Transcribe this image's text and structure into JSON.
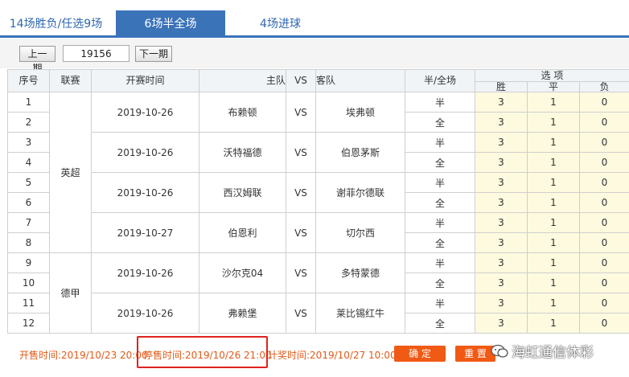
{
  "tabs": [
    {
      "label": "14场胜负/任选9场"
    },
    {
      "label": "6场半全场"
    },
    {
      "label": "4场进球"
    }
  ],
  "toolbar": {
    "prev_label": "上一期",
    "issue_value": "19156",
    "next_label": "下一期"
  },
  "table": {
    "headers": {
      "seq": "序号",
      "league": "联赛",
      "start_time": "开赛时间",
      "home": "主队",
      "vs": "VS",
      "away": "客队",
      "half_full": "半/全场",
      "options": "选 项",
      "win": "胜",
      "draw": "平",
      "lose": "负"
    },
    "matches": [
      {
        "league": "英超",
        "date": "2019-10-26",
        "home": "布赖顿",
        "away": "埃弗顿"
      },
      {
        "league": "英超",
        "date": "2019-10-26",
        "home": "沃特福德",
        "away": "伯恩茅斯"
      },
      {
        "league": "英超",
        "date": "2019-10-26",
        "home": "西汉姆联",
        "away": "谢菲尔德联"
      },
      {
        "league": "英超",
        "date": "2019-10-27",
        "home": "伯恩利",
        "away": "切尔西"
      },
      {
        "league": "德甲",
        "date": "2019-10-26",
        "home": "沙尔克04",
        "away": "多特蒙德"
      },
      {
        "league": "德甲",
        "date": "2019-10-26",
        "home": "弗赖堡",
        "away": "莱比锡红牛"
      }
    ],
    "rows": [
      {
        "seq": "1",
        "hf": "半",
        "win": "3",
        "draw": "1",
        "lose": "0"
      },
      {
        "seq": "2",
        "hf": "全",
        "win": "3",
        "draw": "1",
        "lose": "0"
      },
      {
        "seq": "3",
        "hf": "半",
        "win": "3",
        "draw": "1",
        "lose": "0"
      },
      {
        "seq": "4",
        "hf": "全",
        "win": "3",
        "draw": "1",
        "lose": "0"
      },
      {
        "seq": "5",
        "hf": "半",
        "win": "3",
        "draw": "1",
        "lose": "0"
      },
      {
        "seq": "6",
        "hf": "全",
        "win": "3",
        "draw": "1",
        "lose": "0"
      },
      {
        "seq": "7",
        "hf": "半",
        "win": "3",
        "draw": "1",
        "lose": "0"
      },
      {
        "seq": "8",
        "hf": "全",
        "win": "3",
        "draw": "1",
        "lose": "0"
      },
      {
        "seq": "9",
        "hf": "半",
        "win": "3",
        "draw": "1",
        "lose": "0"
      },
      {
        "seq": "10",
        "hf": "全",
        "win": "3",
        "draw": "1",
        "lose": "0"
      },
      {
        "seq": "11",
        "hf": "半",
        "win": "3",
        "draw": "1",
        "lose": "0"
      },
      {
        "seq": "12",
        "hf": "全",
        "win": "3",
        "draw": "1",
        "lose": "0"
      }
    ],
    "league_groups": [
      {
        "label": "英超",
        "rowspan": 8
      },
      {
        "label": "德甲",
        "rowspan": 4
      }
    ]
  },
  "footer": {
    "sale_open": "开售时间:2019/10/23 20:00",
    "sale_close": "停售时间:2019/10/26 21:00",
    "settle": "计奖时间:2019/10/27 10:00",
    "confirm_label": "确 定",
    "reset_label": "重 置"
  },
  "watermark": {
    "text": "海虹通信体彩"
  },
  "colors": {
    "accent_blue": "#3b73b9",
    "footer_orange": "#e35a18",
    "button_orange": "#f05a14",
    "option_bg": "#fdfadf",
    "highlight_red": "#e0221f"
  }
}
